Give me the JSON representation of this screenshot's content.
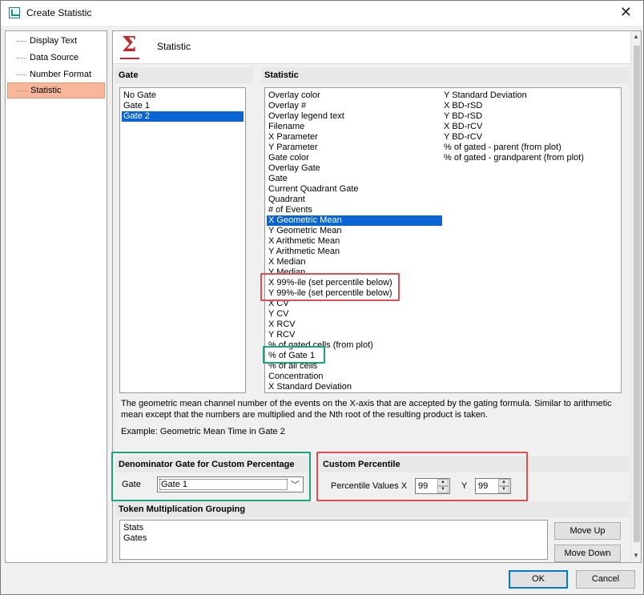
{
  "window": {
    "title": "Create Statistic"
  },
  "nav": {
    "items": [
      {
        "label": "Display Text",
        "selected": false
      },
      {
        "label": "Data Source",
        "selected": false
      },
      {
        "label": "Number Format",
        "selected": false
      },
      {
        "label": "Statistic",
        "selected": true
      }
    ]
  },
  "header": {
    "title": "Statistic"
  },
  "gate_section": {
    "label": "Gate",
    "items": [
      "No Gate",
      "Gate 1",
      "Gate 2"
    ],
    "selected": "Gate 2"
  },
  "statistic_section": {
    "label": "Statistic",
    "col1": [
      "Overlay color",
      "Overlay #",
      "Overlay legend text",
      "Filename",
      "X Parameter",
      "Y Parameter",
      "Gate color",
      "Overlay Gate",
      "Gate",
      "Current Quadrant Gate",
      "Quadrant",
      "# of Events",
      "X Geometric Mean",
      "Y Geometric Mean",
      "X Arithmetic Mean",
      "Y Arithmetic Mean",
      "X Median",
      "Y Median",
      "X 99%-ile (set percentile below)",
      "Y 99%-ile (set percentile below)",
      "X CV",
      "Y CV",
      "X RCV",
      "Y RCV",
      "% of gated cells (from plot)",
      "% of Gate 1",
      "% of all cells",
      "Concentration",
      "X Standard Deviation"
    ],
    "col2": [
      "Y Standard Deviation",
      "X BD-rSD",
      "Y BD-rSD",
      "X BD-rCV",
      "Y BD-rCV",
      "% of gated - parent (from plot)",
      "% of gated - grandparent (from plot)"
    ],
    "selected": "X Geometric Mean"
  },
  "description": {
    "text": "The geometric mean channel number of the events on the X-axis that are accepted by the gating formula. Similar to arithmetic mean except that the numbers are multiplied and the Nth root of the resulting product is taken.",
    "example": "Example: Geometric Mean Time in Gate 2"
  },
  "denominator": {
    "label": "Denominator Gate for Custom Percentage",
    "gate_label": "Gate",
    "value": "Gate 1"
  },
  "percentile": {
    "label": "Custom Percentile",
    "values_label": "Percentile Values X",
    "x": "99",
    "y_label": "Y",
    "y": "99"
  },
  "token": {
    "label": "Token Multiplication Grouping",
    "items": [
      "Stats",
      "Gates"
    ],
    "move_up": "Move Up",
    "move_down": "Move Down"
  },
  "footer": {
    "ok": "OK",
    "cancel": "Cancel"
  },
  "colors": {
    "selection": "#0a64d2",
    "nav_selected": "#f8b79a",
    "highlight_red": "#e05050",
    "highlight_green": "#1fa37f",
    "sigma": "#c1272d"
  }
}
